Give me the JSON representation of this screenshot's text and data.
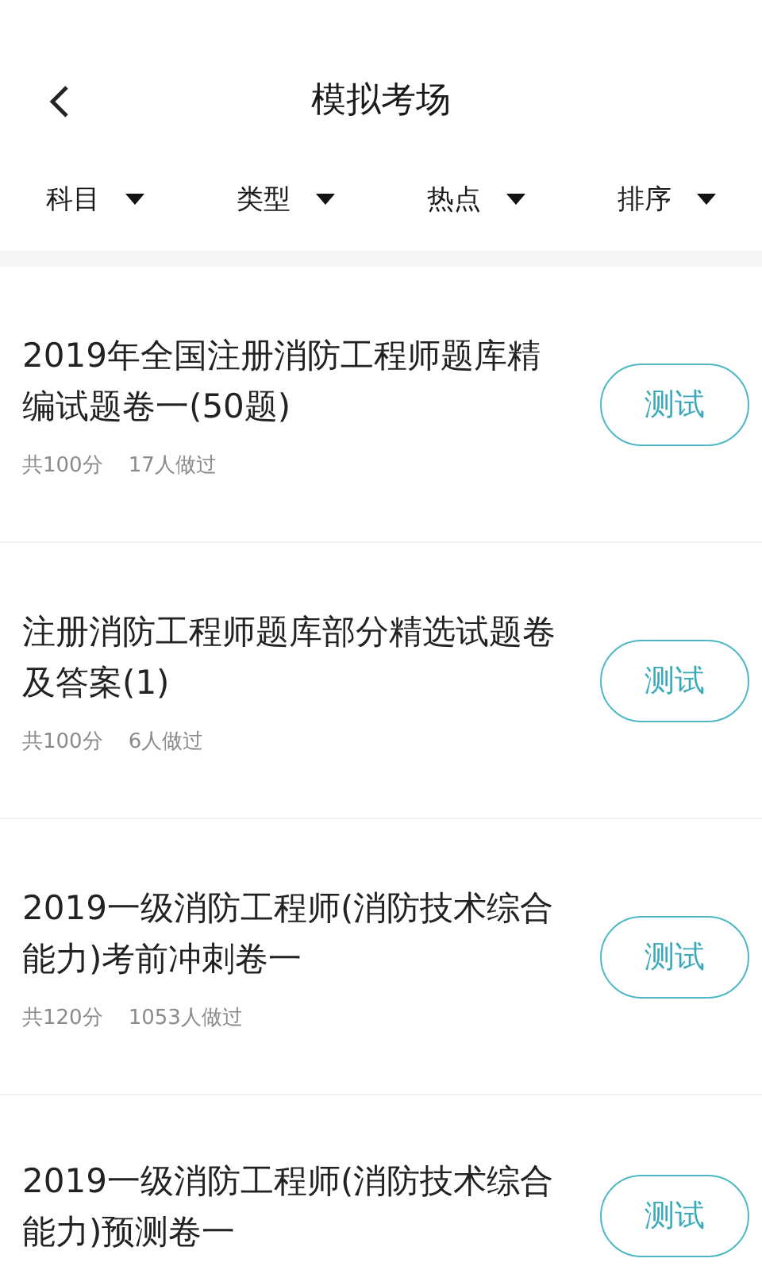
{
  "header": {
    "title": "模拟考场"
  },
  "filters": [
    {
      "label": "科目"
    },
    {
      "label": "类型"
    },
    {
      "label": "热点"
    },
    {
      "label": "排序"
    }
  ],
  "exams": [
    {
      "title": "2019年全国注册消防工程师题库精编试题卷一(50题)",
      "score": "共100分",
      "taken": "17人做过",
      "button": "测试"
    },
    {
      "title": "注册消防工程师题库部分精选试题卷及答案(1)",
      "score": "共100分",
      "taken": "6人做过",
      "button": "测试"
    },
    {
      "title": "2019一级消防工程师(消防技术综合能力)考前冲刺卷一",
      "score": "共120分",
      "taken": "1053人做过",
      "button": "测试"
    },
    {
      "title": "2019一级消防工程师(消防技术综合能力)预测卷一",
      "button": "测试"
    }
  ]
}
